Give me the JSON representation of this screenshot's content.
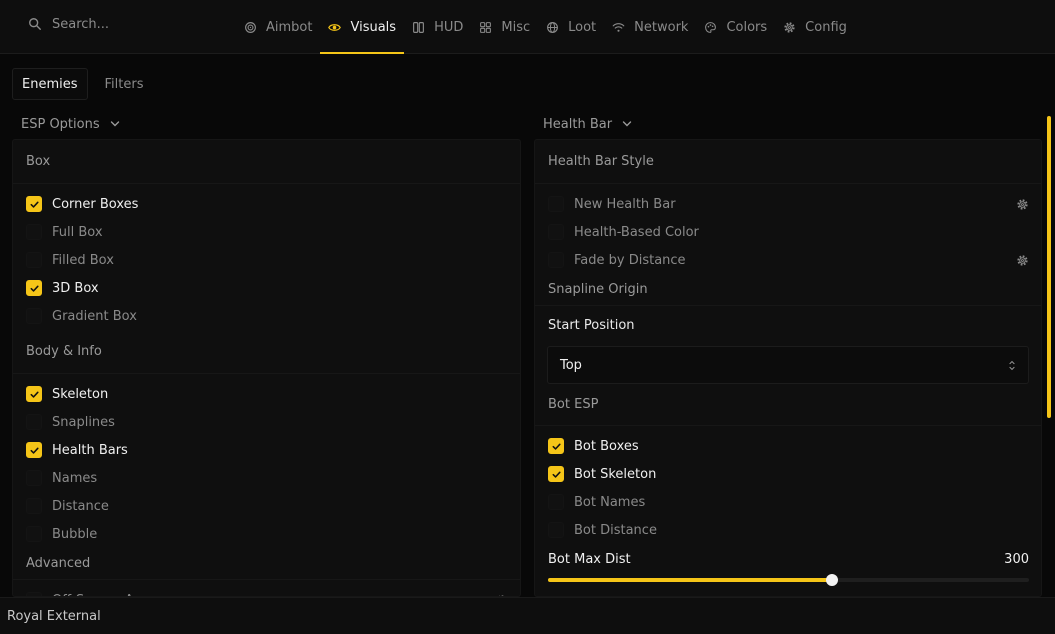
{
  "search": {
    "placeholder": "Search..."
  },
  "nav": [
    {
      "label": "Aimbot",
      "icon": "target-icon",
      "active": false
    },
    {
      "label": "Visuals",
      "icon": "eye-icon",
      "active": true
    },
    {
      "label": "HUD",
      "icon": "hud-icon",
      "active": false
    },
    {
      "label": "Misc",
      "icon": "grid-icon",
      "active": false
    },
    {
      "label": "Loot",
      "icon": "globe-icon",
      "active": false
    },
    {
      "label": "Network",
      "icon": "wifi-icon",
      "active": false
    },
    {
      "label": "Colors",
      "icon": "palette-icon",
      "active": false
    },
    {
      "label": "Config",
      "icon": "gear-icon",
      "active": false
    }
  ],
  "subtabs": [
    {
      "label": "Enemies",
      "active": true
    },
    {
      "label": "Filters",
      "active": false
    }
  ],
  "left": {
    "header": "ESP Options",
    "sections": [
      {
        "title": "Box",
        "items": [
          {
            "label": "Corner Boxes",
            "checked": true
          },
          {
            "label": "Full Box",
            "checked": false
          },
          {
            "label": "Filled Box",
            "checked": false
          },
          {
            "label": "3D Box",
            "checked": true
          },
          {
            "label": "Gradient Box",
            "checked": false
          }
        ]
      },
      {
        "title": "Body & Info",
        "items": [
          {
            "label": "Skeleton",
            "checked": true
          },
          {
            "label": "Snaplines",
            "checked": false
          },
          {
            "label": "Health Bars",
            "checked": true
          },
          {
            "label": "Names",
            "checked": false
          },
          {
            "label": "Distance",
            "checked": false
          },
          {
            "label": "Bubble",
            "checked": false
          }
        ]
      },
      {
        "title": "Advanced",
        "items": [
          {
            "label": "Off-Screen Arrows",
            "checked": false,
            "gear": true
          }
        ]
      }
    ]
  },
  "right": {
    "header": "Health Bar",
    "health_title": "Health Bar Style",
    "health_items": [
      {
        "label": "New Health Bar",
        "checked": false,
        "gear": true
      },
      {
        "label": "Health-Based Color",
        "checked": false,
        "gear": false
      },
      {
        "label": "Fade by Distance",
        "checked": false,
        "gear": true
      }
    ],
    "snapline_title": "Snapline Origin",
    "start_label": "Start Position",
    "start_value": "Top",
    "bot_title": "Bot ESP",
    "bot_items": [
      {
        "label": "Bot Boxes",
        "checked": true
      },
      {
        "label": "Bot Skeleton",
        "checked": true
      },
      {
        "label": "Bot Names",
        "checked": false
      },
      {
        "label": "Bot Distance",
        "checked": false
      }
    ],
    "slider": {
      "label": "Bot Max Dist",
      "value": "300",
      "fraction": 0.59
    }
  },
  "footer": {
    "title": "Royal External"
  },
  "colors": {
    "accent": "#f5c518",
    "background": "#080808",
    "panel": "#0f0f0f"
  }
}
